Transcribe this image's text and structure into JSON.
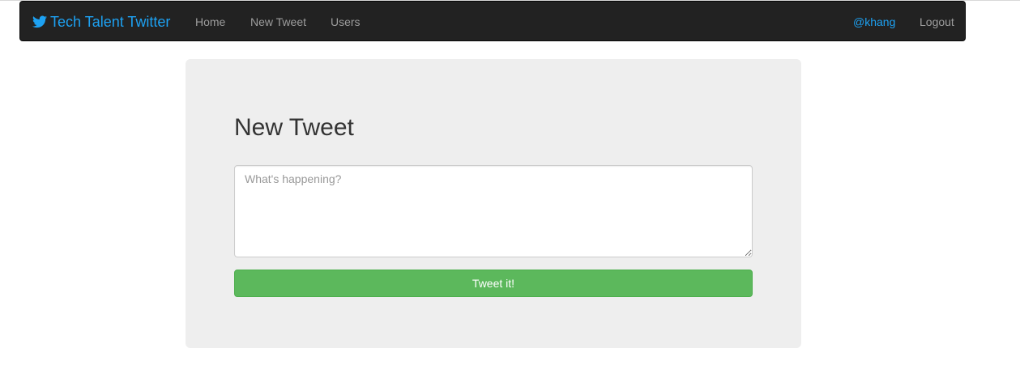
{
  "colors": {
    "brand": "#1da1f2",
    "navbar_bg": "#222222",
    "nav_link": "#9d9d9d",
    "panel_bg": "#eeeeee",
    "button_bg": "#5cb85c"
  },
  "navbar": {
    "brand_icon": "twitter-bird-icon",
    "brand_label": "Tech Talent Twitter",
    "links": [
      "Home",
      "New Tweet",
      "Users"
    ],
    "user_label": "@khang",
    "logout_label": "Logout"
  },
  "main": {
    "title": "New Tweet",
    "tweet_placeholder": "What's happening?",
    "tweet_value": "",
    "submit_label": "Tweet it!"
  }
}
